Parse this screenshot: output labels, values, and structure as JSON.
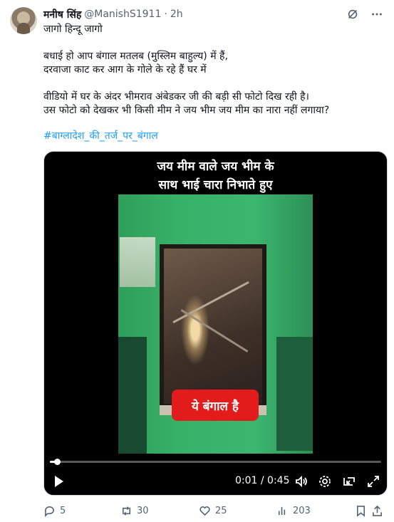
{
  "author": {
    "display_name": "मनीष सिंह",
    "handle": "@ManishS1911",
    "separator": "·",
    "time": "2h"
  },
  "tweet": {
    "lines": [
      "जागो हिन्दू जागो",
      "",
      "बधाई हो आप बंगाल मतलब (मुस्लिम बाहुल्य) में हैं,",
      "दरवाजा काट कर आग के गोले के रहे हैं घर में",
      "",
      "वीडियो में घर के अंदर भीमराव अंबेडकर जी की बड़ी सी फोटो दिख रही है।",
      "उस फोटो को देखकर भी किसी मीम ने जय भीम जय मीम का नारा नहीं लगाया?"
    ],
    "hashtag": "#बाग्लादेश_की_तर्ज_पर_बंगाल"
  },
  "video": {
    "caption_line1": "जय मीम वाले जय भीम के",
    "caption_line2": "साथ भाई चारा निभाते हुए",
    "badge_text": "ये बंगाल है",
    "time_readout": "0:01 / 0:45",
    "progress_fraction": 0.022
  },
  "actions": {
    "replies": "5",
    "reposts": "30",
    "likes": "25",
    "views": "203"
  },
  "icons": {
    "grok": "grok-icon",
    "more": "more-icon",
    "play": "play-icon",
    "volume": "volume-icon",
    "settings": "settings-icon",
    "pip": "picture-in-picture-icon",
    "fullscreen": "fullscreen-icon",
    "reply": "reply-icon",
    "repost": "repost-icon",
    "like": "like-icon",
    "views": "views-icon",
    "bookmark": "bookmark-icon",
    "share": "share-icon"
  }
}
